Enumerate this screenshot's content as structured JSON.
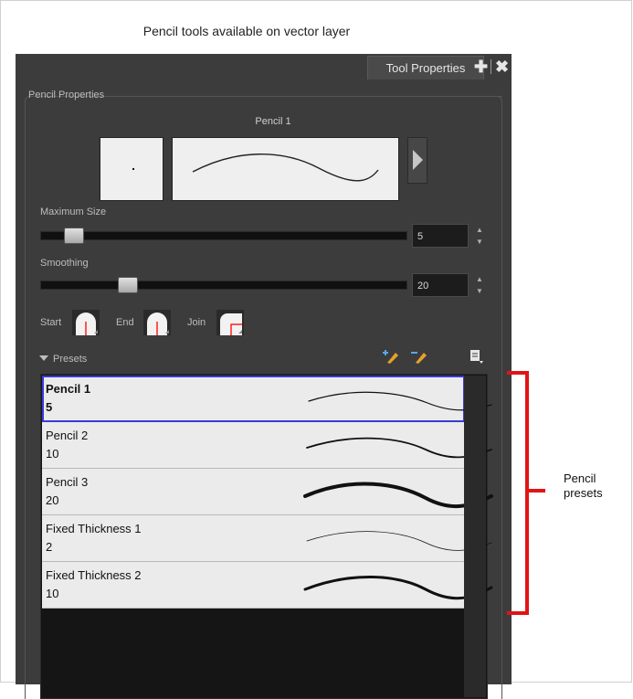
{
  "caption": "Pencil tools available on vector layer",
  "panel": {
    "tab_label": "Tool Properties",
    "group_label": "Pencil Properties",
    "brush_name": "Pencil 1",
    "maximum_size": {
      "label": "Maximum Size",
      "value": "5",
      "fraction": 0.04
    },
    "smoothing": {
      "label": "Smoothing",
      "value": "20",
      "fraction": 0.2
    },
    "caps": {
      "start_label": "Start",
      "end_label": "End",
      "join_label": "Join"
    },
    "presets_label": "Presets",
    "presets": [
      {
        "name": "Pencil 1",
        "size": "5",
        "selected": true
      },
      {
        "name": "Pencil 2",
        "size": "10"
      },
      {
        "name": "Pencil 3",
        "size": "20"
      },
      {
        "name": "Fixed Thickness 1",
        "size": "2"
      },
      {
        "name": "Fixed Thickness 2",
        "size": "10"
      }
    ]
  },
  "callout": {
    "line1": "Pencil",
    "line2": "presets"
  },
  "colors": {
    "panel": "#3c3c3c",
    "selection": "#3a3ad8",
    "annotation": "#e01414",
    "cap_red": "#ff2020"
  },
  "icons": [
    "add-icon",
    "close-icon",
    "scroll-right-arrow-icon",
    "start-cap-icon",
    "end-cap-icon",
    "join-icon",
    "new-preset-icon",
    "delete-preset-icon",
    "preset-menu-icon"
  ]
}
